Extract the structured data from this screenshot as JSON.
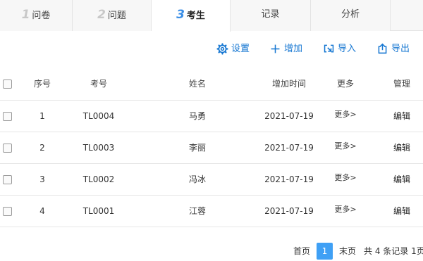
{
  "tabs": [
    {
      "num": "1",
      "label": "问卷",
      "active": false
    },
    {
      "num": "2",
      "label": "问题",
      "active": false
    },
    {
      "num": "3",
      "label": "考生",
      "active": true
    },
    {
      "num": "",
      "label": "记录",
      "active": false
    },
    {
      "num": "",
      "label": "分析",
      "active": false
    }
  ],
  "toolbar": {
    "settings_label": "设置",
    "add_label": "增加",
    "import_label": "导入",
    "export_label": "导出"
  },
  "table": {
    "headers": {
      "no": "序号",
      "code": "考号",
      "name": "姓名",
      "time": "增加时间",
      "more": "更多",
      "manage": "管理"
    },
    "rows": [
      {
        "no": "1",
        "code": "TL0004",
        "name": "马勇",
        "time": "2021-07-19",
        "more": "更多>",
        "edit": "编辑"
      },
      {
        "no": "2",
        "code": "TL0003",
        "name": "李丽",
        "time": "2021-07-19",
        "more": "更多>",
        "edit": "编辑"
      },
      {
        "no": "3",
        "code": "TL0002",
        "name": "冯冰",
        "time": "2021-07-19",
        "more": "更多>",
        "edit": "编辑"
      },
      {
        "no": "4",
        "code": "TL0001",
        "name": "江蓉",
        "time": "2021-07-19",
        "more": "更多>",
        "edit": "编辑"
      }
    ]
  },
  "pager": {
    "first": "首页",
    "current": "1",
    "last": "末页",
    "summary": "共 4 条记录 1页"
  },
  "colors": {
    "accent": "#1677d2",
    "active_tab_number": "#3a8ee6",
    "page_current_bg": "#3fa0f5"
  }
}
